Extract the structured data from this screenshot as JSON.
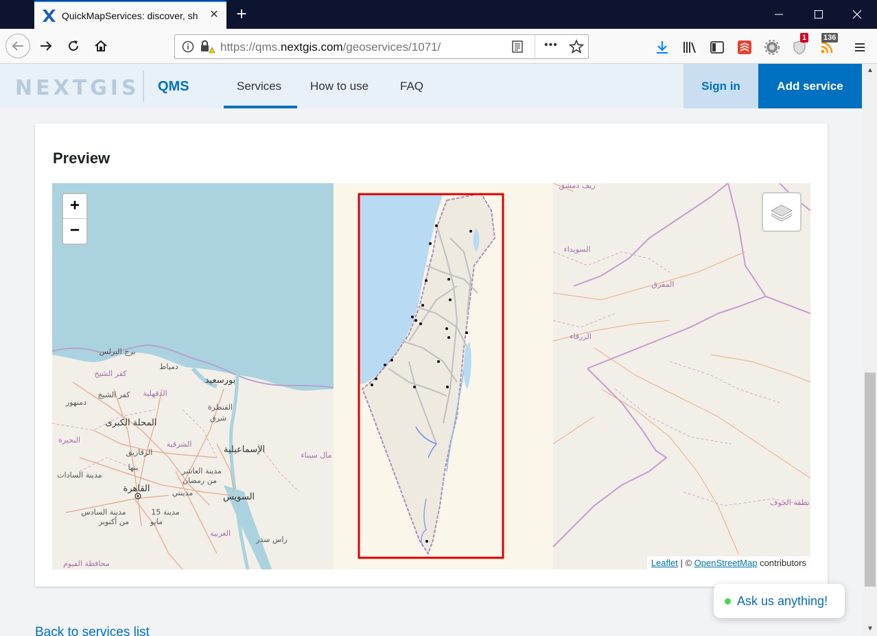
{
  "browser": {
    "tab_title": "QuickMapServices: discover, sh",
    "url_prefix": "https://qms.",
    "url_domain": "nextgis.com",
    "url_path": "/geoservices/1071/",
    "new_tab_symbol": "+",
    "reader_icon": "reader-view-icon",
    "menu_dots": "•••",
    "badge_shield": "1",
    "badge_ext": "136"
  },
  "header": {
    "logo": "NEXTGIS",
    "product": "QMS",
    "menu": [
      "Services",
      "How to use",
      "FAQ"
    ],
    "sign_in": "Sign in",
    "add_service": "Add service"
  },
  "card": {
    "title": "Preview"
  },
  "map": {
    "zoom_in": "+",
    "zoom_out": "−",
    "attribution_leaflet": "Leaflet",
    "attribution_sep": " | © ",
    "attribution_osm": "OpenStreetMap",
    "attribution_suffix": " contributors",
    "labels": {
      "burg_burullus": "برج البرلس",
      "kafr_sheikh_gov": "كفر الشيخ",
      "damietta": "دمياط",
      "port_said": "بورسعيد",
      "dakahlia": "الدقهلية",
      "kafr_sheikh": "كفر الشيخ",
      "damanhur": "دمنهور",
      "mahalla": "المحلة الكبرى",
      "qantara": "القنطرة",
      "sharq": "شرق",
      "buhayra": "البحيرة",
      "sharqia": "الشرقية",
      "ismailia": "الإسماعيلية",
      "zagazig": "الزقازيق",
      "banha": "بنها",
      "sadat": "مدينة السادات",
      "tenth_ramadan": "مدينة العاشر",
      "min_ramadan": "من رمضان",
      "cairo": "القاهرة",
      "badr": "مدينتي",
      "suez": "السويس",
      "sixth_october": "مدينة السادس",
      "min_october": "من أكتوبر",
      "fifteen_may": "مدينة 15",
      "mayo": "مايو",
      "gharbia": "الغربية",
      "ras_sudr": "راس سدر",
      "fayoum": "محافظة الفيوم",
      "north_sinai": "مال سيناء",
      "rif_dimashq": "ريف دمشق",
      "sweida": "السويداء",
      "mafraq": "المفرق",
      "zarqa": "الزرقاء",
      "jawf": "نطقة الجوف"
    }
  },
  "chat": {
    "label": "Ask us anything!"
  },
  "footer": {
    "back_link": "Back to services list"
  },
  "colors": {
    "brand_blue": "#0071bc",
    "sea": "#aad3df",
    "coverage_box": "#e00000"
  }
}
